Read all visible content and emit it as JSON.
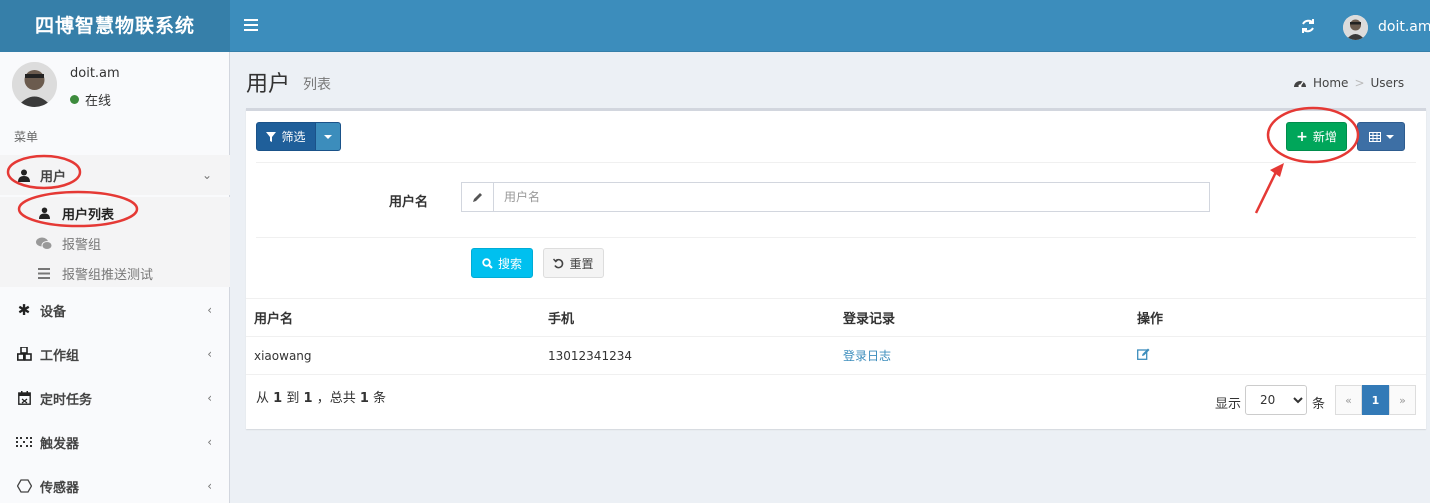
{
  "app": {
    "logo_text": "四博智慧物联系统"
  },
  "navbar": {
    "user_name": "doit.am",
    "refresh_icon": "refresh-icon",
    "menu_icon": "hamburger-icon"
  },
  "sidebar": {
    "user": {
      "name": "doit.am",
      "status": "在线",
      "status_color": "#3d8b3d"
    },
    "header": "菜单",
    "items": [
      {
        "label": "用户",
        "icon": "user-icon",
        "expanded": true
      },
      {
        "label": "设备",
        "icon": "asterisk-icon"
      },
      {
        "label": "工作组",
        "icon": "cubes-icon"
      },
      {
        "label": "定时任务",
        "icon": "calendar-icon"
      },
      {
        "label": "触发器",
        "icon": "dots-grid-icon"
      },
      {
        "label": "传感器",
        "icon": "hexagon-icon"
      }
    ],
    "submenu": [
      {
        "label": "用户列表",
        "icon": "user-icon",
        "active": true
      },
      {
        "label": "报警组",
        "icon": "wechat-icon"
      },
      {
        "label": "报警组推送测试",
        "icon": "list-icon"
      }
    ]
  },
  "content": {
    "title": "用户",
    "subtitle": "列表",
    "breadcrumb": {
      "home": "Home",
      "current": "Users"
    }
  },
  "toolbar": {
    "filter_label": "筛选",
    "add_label": "新增"
  },
  "search": {
    "field_label": "用户名",
    "placeholder": "用户名",
    "search_label": "搜索",
    "reset_label": "重置"
  },
  "table": {
    "columns": [
      "用户名",
      "手机",
      "登录记录",
      "操作"
    ],
    "rows": [
      {
        "username": "xiaowang",
        "phone": "13012341234",
        "login_log": "登录日志",
        "action_icon": "edit-icon"
      }
    ]
  },
  "footer": {
    "summary_prefix": "从",
    "from": "1",
    "summary_to": "到",
    "to": "1",
    "summary_total": "，总共",
    "total": "1",
    "summary_unit": "条",
    "show_label": "显示",
    "per_page": "20",
    "unit_label": "条",
    "pages": {
      "prev": "«",
      "current": "1",
      "next": "»"
    }
  },
  "colors": {
    "header_bg": "#3c8dbc",
    "logo_bg": "#367fa9",
    "add_btn": "#00a65a",
    "search_btn": "#00c0ef",
    "annotation": "#e53935"
  }
}
